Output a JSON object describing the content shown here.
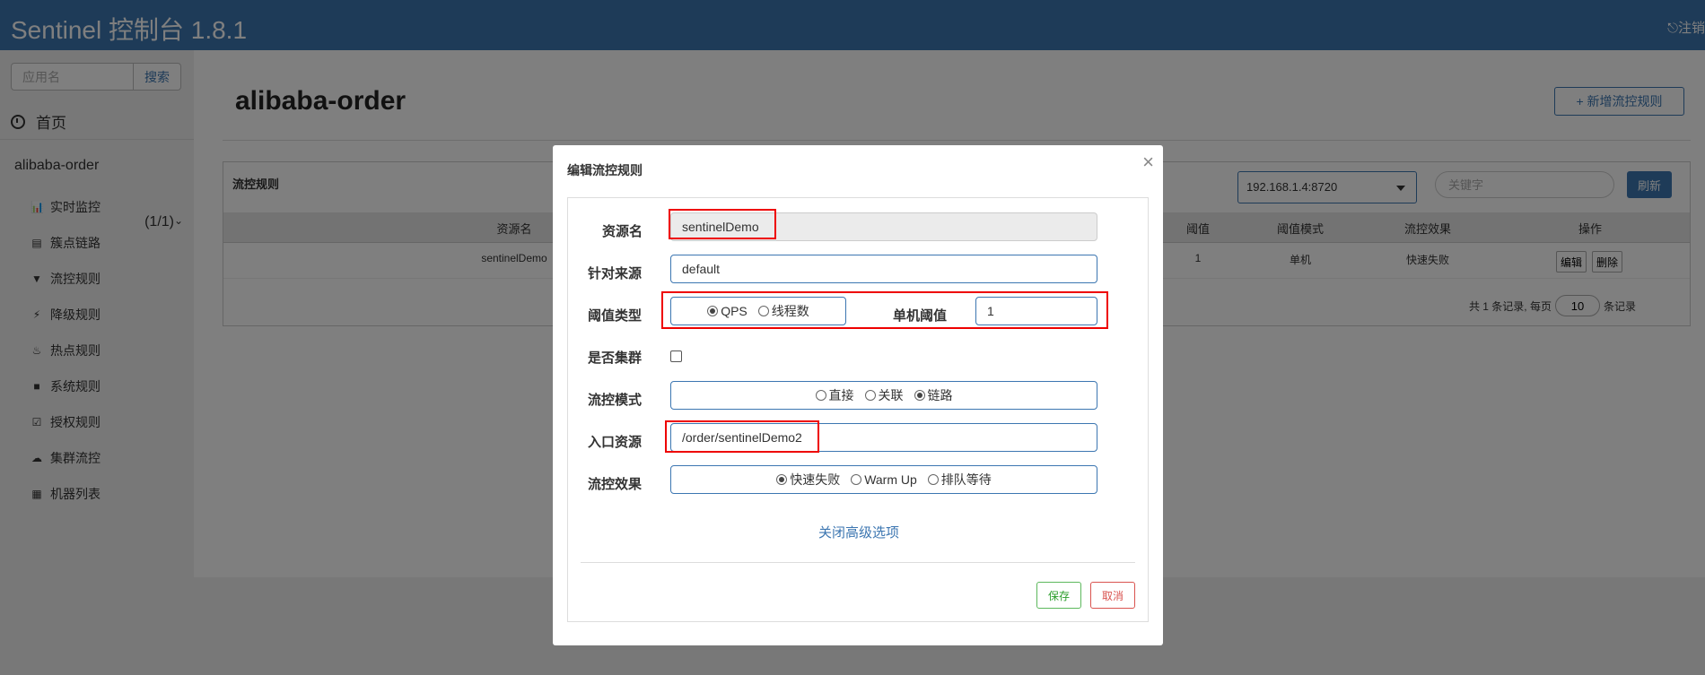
{
  "header": {
    "title": "Sentinel 控制台 1.8.1",
    "logout_label": "⎋注销"
  },
  "sidebar": {
    "search_placeholder": "应用名",
    "search_button": "搜索",
    "home_label": "首页",
    "app": {
      "name": "alibaba-order",
      "count": "(1/1)"
    },
    "menu": [
      {
        "icon": "bar-chart-icon",
        "glyph": "📊",
        "label": "实时监控"
      },
      {
        "icon": "list-icon",
        "glyph": "▤",
        "label": "簇点链路"
      },
      {
        "icon": "filter-icon",
        "glyph": "▼",
        "label": "流控规则"
      },
      {
        "icon": "bolt-icon",
        "glyph": "⚡",
        "label": "降级规则"
      },
      {
        "icon": "fire-icon",
        "glyph": "♨",
        "label": "热点规则"
      },
      {
        "icon": "lock-icon",
        "glyph": "■",
        "label": "系统规则"
      },
      {
        "icon": "check-square-icon",
        "glyph": "☑",
        "label": "授权规则"
      },
      {
        "icon": "cloud-icon",
        "glyph": "☁",
        "label": "集群流控"
      },
      {
        "icon": "th-list-icon",
        "glyph": "▦",
        "label": "机器列表"
      }
    ]
  },
  "main": {
    "title": "alibaba-order",
    "add_rule_button": "+ 新增流控规则",
    "panel": {
      "title": "流控规则",
      "ip_value": "192.168.1.4:8720",
      "keyword_placeholder": "关键字",
      "refresh_button": "刷新",
      "columns": [
        "资源名",
        "阈值",
        "阈值模式",
        "流控效果",
        "操作"
      ],
      "row": {
        "resource": "sentinelDemo",
        "threshold": "1",
        "threshold_mode": "单机",
        "effect": "快速失败",
        "edit": "编辑",
        "delete": "删除"
      },
      "pager": {
        "prefix": "共 1 条记录, 每页",
        "page_size": "10",
        "suffix": "条记录"
      }
    }
  },
  "modal": {
    "title": "编辑流控规则",
    "close_glyph": "×",
    "fields": {
      "resource": {
        "label": "资源名",
        "value": "sentinelDemo"
      },
      "origin": {
        "label": "针对来源",
        "value": "default"
      },
      "grade": {
        "label": "阈值类型",
        "options": [
          "QPS",
          "线程数"
        ],
        "selected": "QPS"
      },
      "threshold": {
        "label": "单机阈值",
        "value": "1"
      },
      "cluster": {
        "label": "是否集群",
        "checked": false
      },
      "strategy": {
        "label": "流控模式",
        "options": [
          "直接",
          "关联",
          "链路"
        ],
        "selected": "链路"
      },
      "entry": {
        "label": "入口资源",
        "value": "/order/sentinelDemo2"
      },
      "behavior": {
        "label": "流控效果",
        "options": [
          "快速失败",
          "Warm Up",
          "排队等待"
        ],
        "selected": "快速失败"
      }
    },
    "advanced_link": "关闭高级选项",
    "save_button": "保存",
    "cancel_button": "取消"
  }
}
